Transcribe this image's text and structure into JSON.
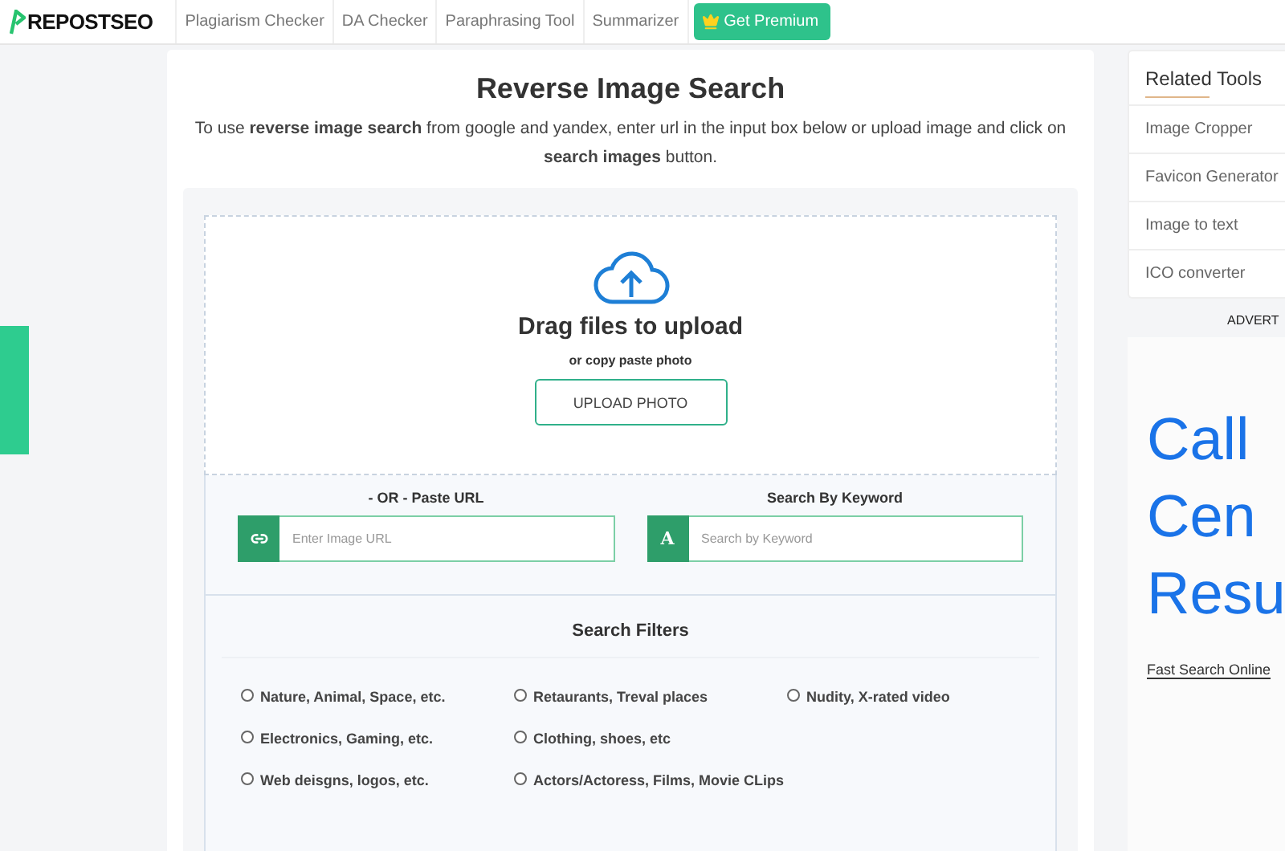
{
  "navbar": {
    "logo": "REPOSTSEO",
    "links": [
      {
        "label": "Plagiarism Checker"
      },
      {
        "label": "DA Checker"
      },
      {
        "label": "Paraphrasing Tool"
      },
      {
        "label": "Summarizer"
      }
    ],
    "premium_button": "Get Premium"
  },
  "main": {
    "title": "Reverse Image Search",
    "description": "To use **reverse image search** from google and yandex, enter url in the input box below or upload image and click on **search images** button.",
    "upload": {
      "heading": "Drag files to upload",
      "subheading": "or copy paste photo",
      "button": "UPLOAD PHOTO"
    },
    "url_field": {
      "label": "- OR - Paste URL",
      "placeholder": "Enter Image URL"
    },
    "keyword_field": {
      "label": "Search By Keyword",
      "icon_text": "A",
      "placeholder": "Search by Keyword"
    },
    "filters": {
      "title": "Search Filters",
      "options": [
        {
          "label": "Nature, Animal, Space, etc.",
          "selected": false
        },
        {
          "label": "Retaurants, Treval places",
          "selected": false
        },
        {
          "label": "Nudity, X-rated video",
          "selected": false
        },
        {
          "label": "Electronics, Gaming, etc.",
          "selected": false
        },
        {
          "label": "Clothing, shoes, etc",
          "selected": false
        },
        {
          "label": "Web deisgns, logos, etc.",
          "selected": false
        },
        {
          "label": "Actors/Actoress, Films, Movie CLips",
          "selected": false
        }
      ]
    }
  },
  "sidebar": {
    "title": "Related Tools",
    "items": [
      {
        "label": "Image Cropper"
      },
      {
        "label": "Favicon Generator"
      },
      {
        "label": "Image to text"
      },
      {
        "label": "ICO converter"
      }
    ],
    "ad_label": "ADVERT",
    "ad_lines": [
      "Call",
      "Cen",
      "Resu"
    ],
    "ad_link": "Fast Search Online"
  }
}
